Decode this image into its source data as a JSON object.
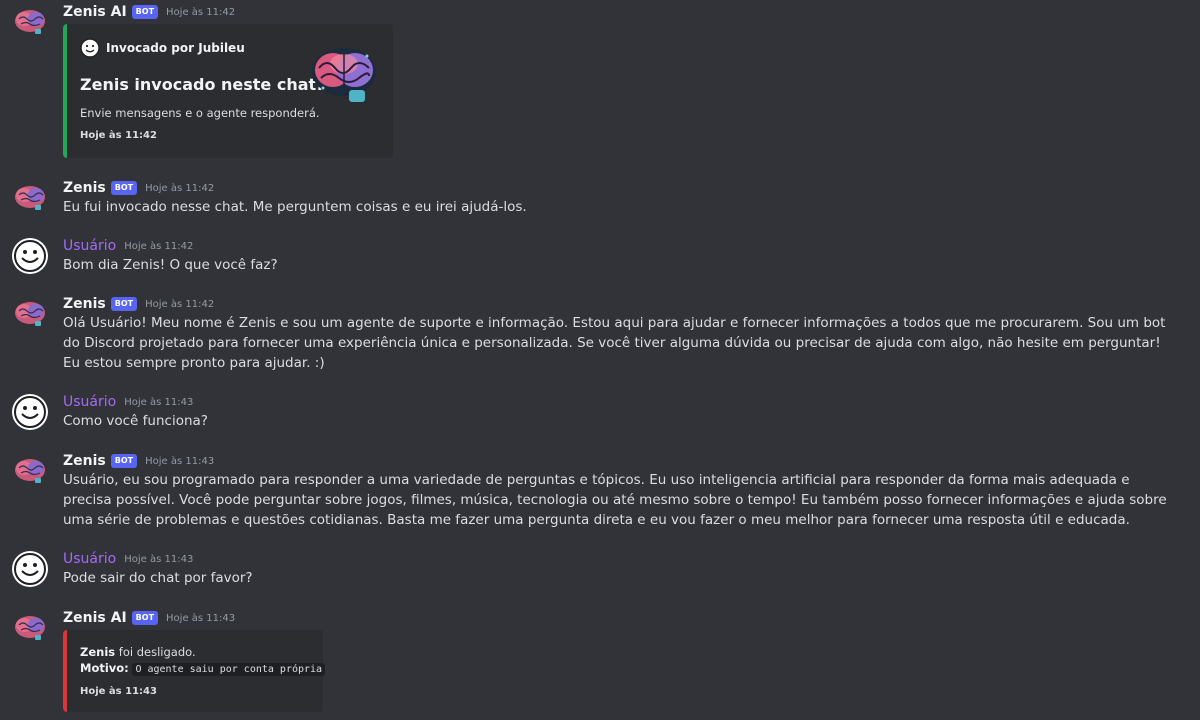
{
  "colors": {
    "background": "#313338",
    "embed_bg": "#2b2d31",
    "bot_tag": "#5865f2",
    "user_name": "#a36af7",
    "embed_green": "#23a55a",
    "embed_red": "#da373c"
  },
  "messages": [
    {
      "author": "Zenis AI",
      "bot_tag": "BOT",
      "time": "Hoje às 11:42",
      "embed": {
        "author": "Invocado por Jubileu",
        "title": "Zenis invocado neste chat!",
        "description": "Envie mensagens e o agente responderá.",
        "footer": "Hoje às 11:42",
        "thumbnail_icon": "brain-icon"
      }
    },
    {
      "author": "Zenis",
      "bot_tag": "BOT",
      "time": "Hoje às 11:42",
      "text": "Eu fui invocado nesse chat. Me perguntem coisas e eu irei ajudá-los."
    },
    {
      "author": "Usuário",
      "time": "Hoje às 11:42",
      "text": "Bom dia Zenis! O que você faz?"
    },
    {
      "author": "Zenis",
      "bot_tag": "BOT",
      "time": "Hoje às 11:42",
      "text": "Olá Usuário! Meu nome é Zenis e sou um agente de suporte e informação. Estou aqui para ajudar e fornecer informações a todos que me procurarem. Sou um bot do Discord projetado para fornecer uma experiência única e personalizada. Se você tiver alguma dúvida ou precisar de ajuda com algo, não hesite em perguntar! Eu estou sempre pronto para ajudar. :)"
    },
    {
      "author": "Usuário",
      "time": "Hoje às 11:43",
      "text": "Como você funciona?"
    },
    {
      "author": "Zenis",
      "bot_tag": "BOT",
      "time": "Hoje às 11:43",
      "text": "Usuário, eu sou programado para responder a uma variedade de perguntas e tópicos. Eu uso inteligencia artificial para responder da forma mais adequada e precisa possível. Você pode perguntar sobre jogos, filmes, música, tecnologia ou até mesmo sobre o tempo! Eu também posso fornecer informações e ajuda sobre uma série de problemas e questões cotidianas. Basta me fazer uma pergunta direta e eu vou fazer o meu melhor para fornecer uma resposta útil e educada."
    },
    {
      "author": "Usuário",
      "time": "Hoje às 11:43",
      "text": "Pode sair do chat por favor?"
    },
    {
      "author": "Zenis AI",
      "bot_tag": "BOT",
      "time": "Hoje às 11:43",
      "embed": {
        "line1_bold": "Zenis",
        "line1_rest": " foi desligado.",
        "line2_label": "Motivo:",
        "line2_code": "O agente saiu por conta própria",
        "footer": "Hoje às 11:43"
      }
    }
  ]
}
